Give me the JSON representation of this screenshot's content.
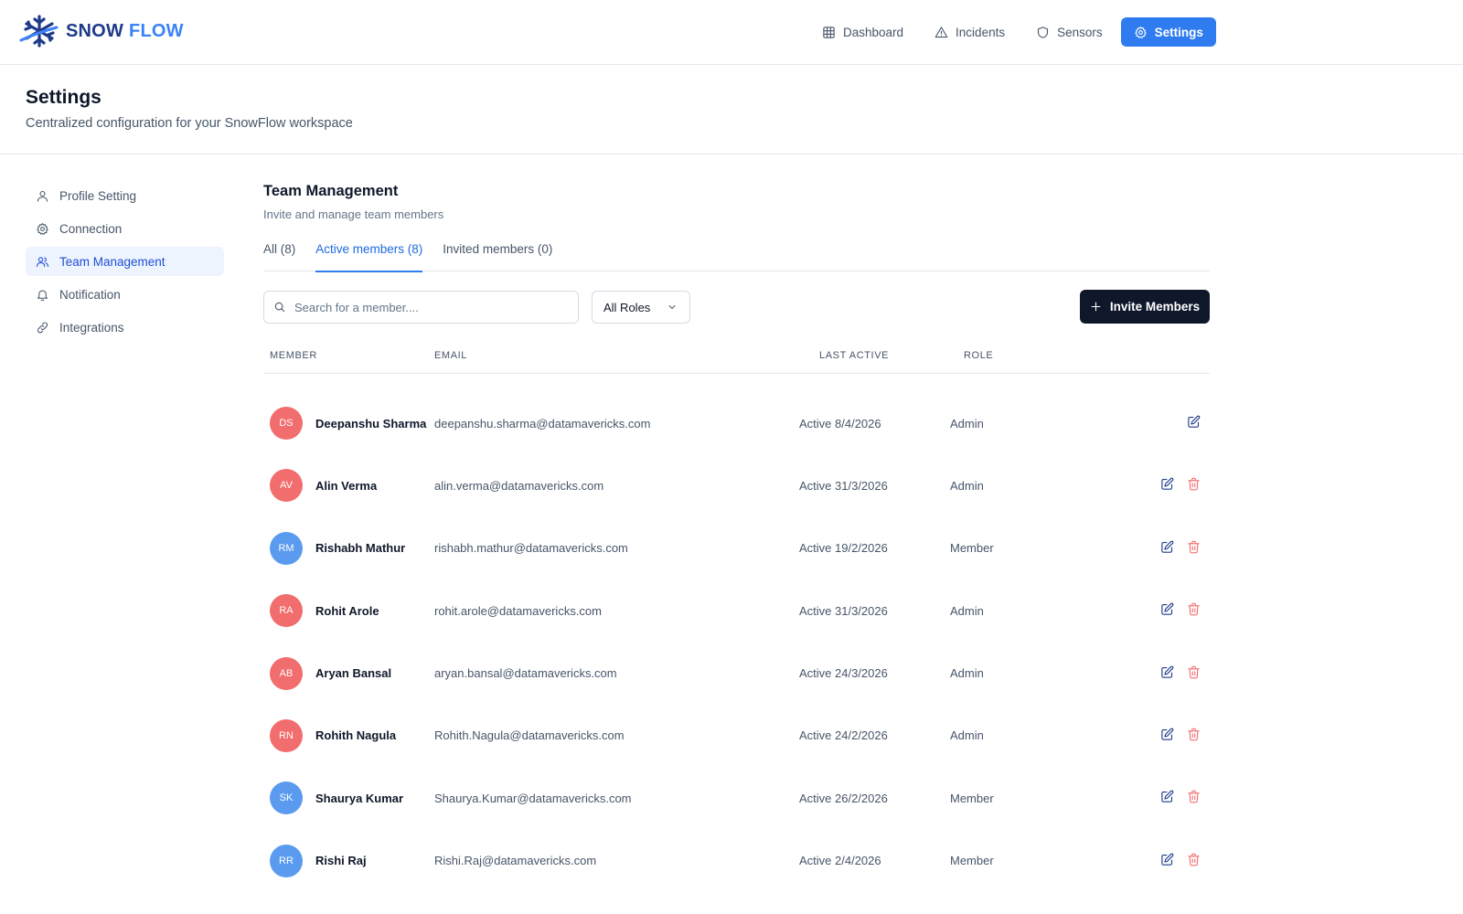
{
  "brand": {
    "word1": "SNOW",
    "word2": "FLOW",
    "color_primary": "#1e3a8a",
    "color_accent": "#3b82f6"
  },
  "nav": {
    "items": [
      {
        "label": "Dashboard",
        "icon": "grid-icon",
        "active": false
      },
      {
        "label": "Incidents",
        "icon": "warning-triangle-icon",
        "active": false
      },
      {
        "label": "Sensors",
        "icon": "shield-icon",
        "active": false
      },
      {
        "label": "Settings",
        "icon": "gear-icon",
        "active": true
      }
    ],
    "active_color": "#2f7bf0"
  },
  "page": {
    "title": "Settings",
    "subtitle": "Centralized configuration for your SnowFlow workspace"
  },
  "sidebar": {
    "items": [
      {
        "label": "Profile Setting",
        "icon": "user-icon",
        "active": false
      },
      {
        "label": "Connection",
        "icon": "gear-icon",
        "active": false
      },
      {
        "label": "Team Management",
        "icon": "users-icon",
        "active": true
      },
      {
        "label": "Notification",
        "icon": "bell-icon",
        "active": false
      },
      {
        "label": "Integrations",
        "icon": "link-icon",
        "active": false
      }
    ]
  },
  "team": {
    "title": "Team Management",
    "subtitle": "Invite and manage team members",
    "tabs": [
      {
        "label": "All (8)",
        "active": false
      },
      {
        "label": "Active members (8)",
        "active": true
      },
      {
        "label": "Invited members (0)",
        "active": false
      }
    ],
    "search_placeholder": "Search for a member....",
    "role_filter": "All Roles",
    "invite_label": "Invite Members",
    "columns": {
      "member": "MEMBER",
      "email": "EMAIL",
      "last_active": "LAST ACTIVE",
      "role": "ROLE"
    },
    "members": [
      {
        "initials": "DS",
        "name": "Deepanshu Sharma",
        "email": "deepanshu.sharma@datamavericks.com",
        "last_active": "Active 8/4/2026",
        "role": "Admin",
        "avatar_color": "red",
        "deletable": false
      },
      {
        "initials": "AV",
        "name": "Alin Verma",
        "email": "alin.verma@datamavericks.com",
        "last_active": "Active 31/3/2026",
        "role": "Admin",
        "avatar_color": "red",
        "deletable": true
      },
      {
        "initials": "RM",
        "name": "Rishabh Mathur",
        "email": "rishabh.mathur@datamavericks.com",
        "last_active": "Active 19/2/2026",
        "role": "Member",
        "avatar_color": "blue",
        "deletable": true
      },
      {
        "initials": "RA",
        "name": "Rohit Arole",
        "email": "rohit.arole@datamavericks.com",
        "last_active": "Active 31/3/2026",
        "role": "Admin",
        "avatar_color": "red",
        "deletable": true
      },
      {
        "initials": "AB",
        "name": "Aryan Bansal",
        "email": "aryan.bansal@datamavericks.com",
        "last_active": "Active 24/3/2026",
        "role": "Admin",
        "avatar_color": "red",
        "deletable": true
      },
      {
        "initials": "RN",
        "name": "Rohith Nagula",
        "email": "Rohith.Nagula@datamavericks.com",
        "last_active": "Active 24/2/2026",
        "role": "Admin",
        "avatar_color": "red",
        "deletable": true
      },
      {
        "initials": "SK",
        "name": "Shaurya Kumar",
        "email": "Shaurya.Kumar@datamavericks.com",
        "last_active": "Active 26/2/2026",
        "role": "Member",
        "avatar_color": "blue",
        "deletable": true
      },
      {
        "initials": "RR",
        "name": "Rishi Raj",
        "email": "Rishi.Raj@datamavericks.com",
        "last_active": "Active 2/4/2026",
        "role": "Member",
        "avatar_color": "blue",
        "deletable": true
      }
    ]
  }
}
